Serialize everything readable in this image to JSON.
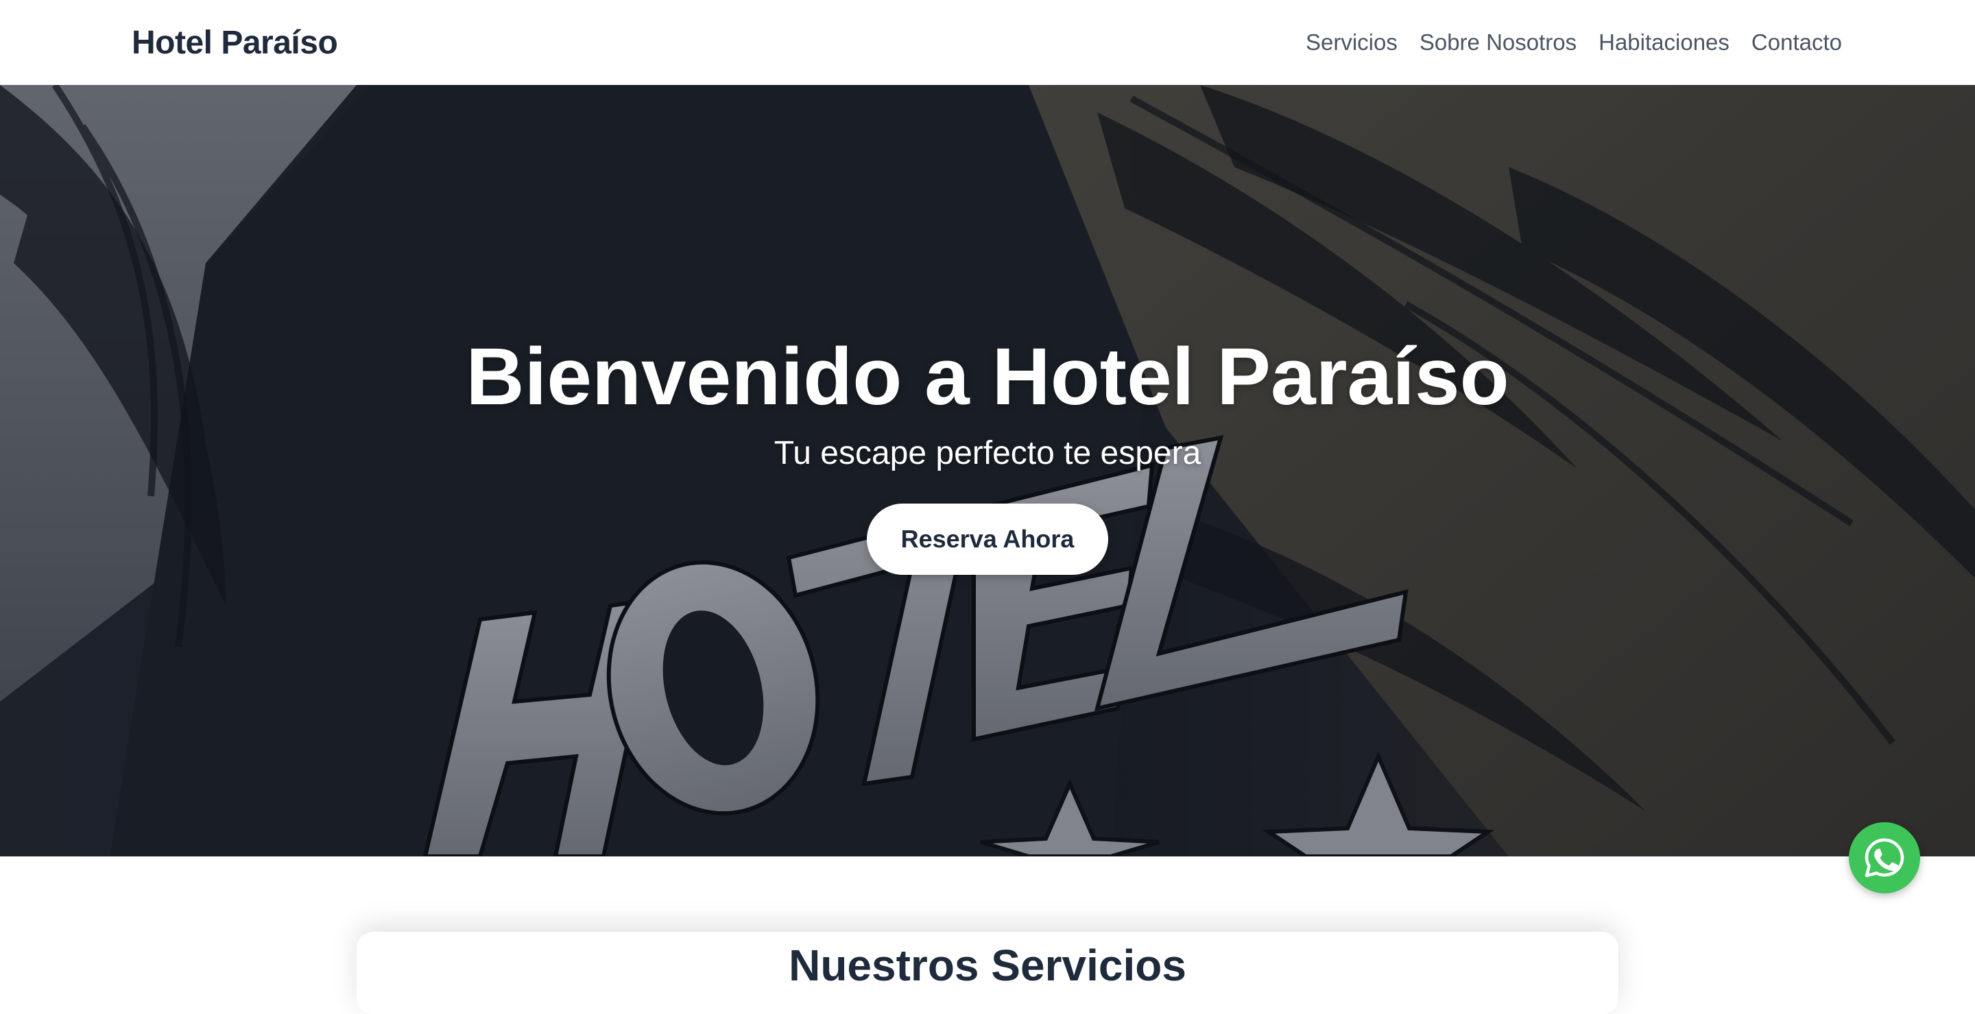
{
  "header": {
    "brand": "Hotel Paraíso",
    "nav": [
      {
        "label": "Servicios"
      },
      {
        "label": "Sobre Nosotros"
      },
      {
        "label": "Habitaciones"
      },
      {
        "label": "Contacto"
      }
    ]
  },
  "hero": {
    "title": "Bienvenido a Hotel Paraíso",
    "subtitle": "Tu escape perfecto te espera",
    "cta_label": "Reserva Ahora",
    "background_image": {
      "sign_text": "HOTEL",
      "content": "hotel facade sign with stars and palm shadows"
    }
  },
  "services_section": {
    "heading": "Nuestros Servicios"
  },
  "floating": {
    "whatsapp_icon": "whatsapp-icon",
    "whatsapp_color": "#3fc45a"
  },
  "colors": {
    "brand_text": "#1f2a3c",
    "nav_text": "#4b5563",
    "hero_overlay": "#1d222d"
  }
}
